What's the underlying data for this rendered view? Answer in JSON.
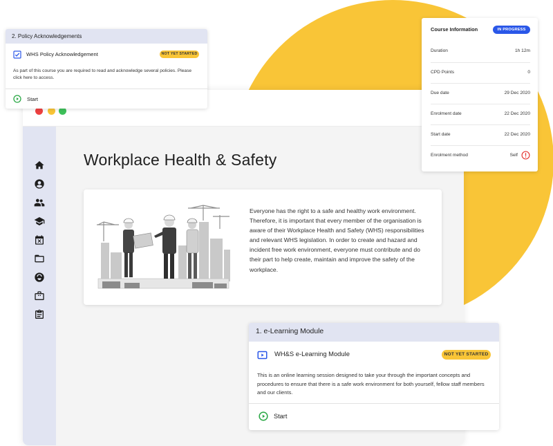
{
  "colors": {
    "accent_yellow": "#f9c537",
    "sidebar_bg": "#e1e4f2",
    "status_blue": "#2a57e8",
    "play_green": "#2aa845",
    "alert_red": "#e53935"
  },
  "page": {
    "title": "Workplace Health & Safety"
  },
  "hero": {
    "text": "Everyone has the right to a safe and healthy work environment. Therefore, it is important that every member of the organisation is aware of their Workplace Health and Safety (WHS) responsibilities and relevant WHS legislation. In order to create and hazard and incident free work environment, everyone must contribute and do their part to help create, maintain and improve the safety of the workplace."
  },
  "sidebar": {
    "icons": [
      "home-icon",
      "account-icon",
      "users-icon",
      "graduation-cap-icon",
      "calendar-icon",
      "folder-icon",
      "support-icon",
      "briefcase-icon",
      "clipboard-icon"
    ]
  },
  "policy_card": {
    "heading": "2. Policy Acknowledgements",
    "item_name": "WHS Policy Acknowledgement",
    "status": "NOT YET STARTED",
    "description": "As part of this course you are required to read and acknowledge several policies. Please click here to access.",
    "start_label": "Start"
  },
  "course_info": {
    "heading": "Course Information",
    "status": "IN PROGRESS",
    "rows": [
      {
        "label": "Duration",
        "value": "1h 12m"
      },
      {
        "label": "CPD Points",
        "value": "0"
      },
      {
        "label": "Due date",
        "value": "29 Dec 2020"
      },
      {
        "label": "Enrolment date",
        "value": "22 Dec 2020"
      },
      {
        "label": "Start date",
        "value": "22 Dec 2020"
      },
      {
        "label": "Enrolment method",
        "value": "Self"
      }
    ]
  },
  "elearning_card": {
    "heading": "1. e-Learning Module",
    "item_name": "WH&S e-Learning Module",
    "status": "NOT YET STARTED",
    "description": "This is an online learning session designed to take your through the important concepts and procedures to ensure that there is a safe work environment for both yourself, fellow staff members and our clients.",
    "start_label": "Start"
  }
}
